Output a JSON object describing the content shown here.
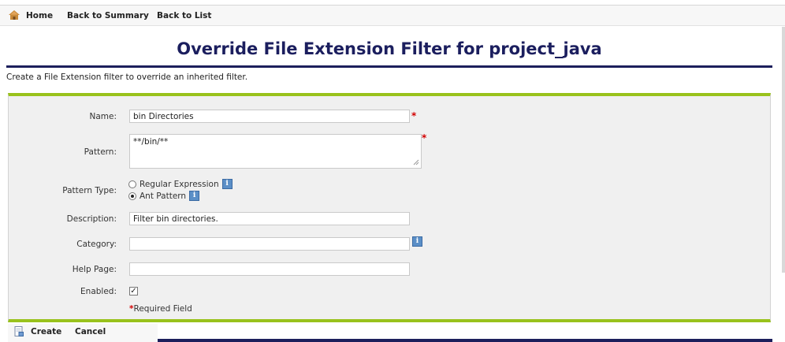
{
  "nav": {
    "home": "Home",
    "back_to_summary": "Back to Summary",
    "back_to_list": "Back to List"
  },
  "page": {
    "title": "Override File Extension Filter for project_java",
    "description": "Create a File Extension filter to override an inherited filter."
  },
  "form": {
    "name": {
      "label": "Name:",
      "value": "bin Directories"
    },
    "pattern": {
      "label": "Pattern:",
      "value": "**/bin/**"
    },
    "pattern_type": {
      "label": "Pattern Type:",
      "options": [
        "Regular Expression",
        "Ant Pattern"
      ],
      "selected": "Ant Pattern"
    },
    "description": {
      "label": "Description:",
      "value": "Filter bin directories."
    },
    "category": {
      "label": "Category:",
      "value": ""
    },
    "help_page": {
      "label": "Help Page:",
      "value": ""
    },
    "enabled": {
      "label": "Enabled:",
      "checked": true
    },
    "required_star": "*",
    "required_note": "Required Field"
  },
  "actions": {
    "create": "Create",
    "cancel": "Cancel"
  },
  "icons": {
    "home": "home-icon",
    "info": "info-icon",
    "create": "create-icon"
  },
  "colors": {
    "accent_green": "#99c21c",
    "title_navy": "#1b1e5e",
    "required_red": "#d20000"
  }
}
